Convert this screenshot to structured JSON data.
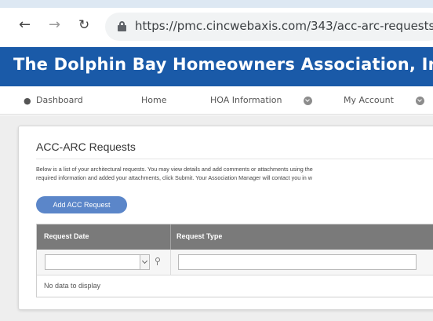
{
  "browser": {
    "url": "https://pmc.cincwebaxis.com/343/acc-arc-requests/"
  },
  "site": {
    "title": "The Dolphin Bay Homeowners Association, Inc."
  },
  "menu": {
    "items": [
      {
        "label": "Dashboard"
      },
      {
        "label": "Home"
      },
      {
        "label": "HOA Information"
      },
      {
        "label": "My Account"
      }
    ]
  },
  "page": {
    "title": "ACC-ARC Requests",
    "description_line1": "Below is a list of your architectural requests. You may view details and add comments or attachments using the",
    "description_line2": "required information and added your attachments, click Submit. Your Association Manager will contact you in w",
    "add_button_label": "Add ACC Request"
  },
  "grid": {
    "columns": [
      "Request Date",
      "Request Type"
    ],
    "empty_text": "No data to display"
  },
  "colors": {
    "header_bg": "#1a5aa8",
    "button_bg": "#5b86c9",
    "grid_header_bg": "#7a7a7a"
  }
}
